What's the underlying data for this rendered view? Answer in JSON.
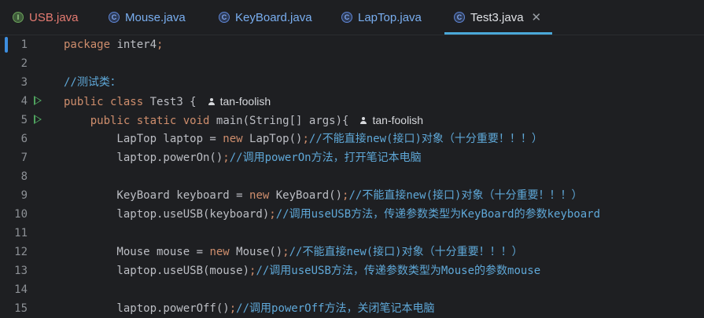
{
  "tabs": [
    {
      "label": "USB.java",
      "icon": "interface-icon",
      "icon_letter": "I",
      "state": "error"
    },
    {
      "label": "Mouse.java",
      "icon": "class-icon",
      "icon_letter": "C",
      "state": "modified"
    },
    {
      "label": "KeyBoard.java",
      "icon": "class-icon",
      "icon_letter": "C",
      "state": "modified"
    },
    {
      "label": "LapTop.java",
      "icon": "class-icon",
      "icon_letter": "C",
      "state": "modified"
    },
    {
      "label": "Test3.java",
      "icon": "class-icon",
      "icon_letter": "C",
      "state": "active",
      "close": "✕"
    }
  ],
  "author_hint": "tan-foolish",
  "lines": [
    {
      "n": "1",
      "code": "package inter4;"
    },
    {
      "n": "2",
      "code": ""
    },
    {
      "n": "3",
      "code": "//测试类："
    },
    {
      "n": "4",
      "code": "public class Test3 {"
    },
    {
      "n": "5",
      "code": "    public static void main(String[] args){"
    },
    {
      "n": "6",
      "code": "        LapTop laptop = new LapTop();//不能直接new(接口)对象（十分重要！！！）"
    },
    {
      "n": "7",
      "code": "        laptop.powerOn();//调用powerOn方法，打开笔记本电脑"
    },
    {
      "n": "8",
      "code": ""
    },
    {
      "n": "9",
      "code": "        KeyBoard keyboard = new KeyBoard();//不能直接new(接口)对象（十分重要！！！）"
    },
    {
      "n": "10",
      "code": "        laptop.useUSB(keyboard);//调用useUSB方法，传递参数类型为KeyBoard的参数keyboard"
    },
    {
      "n": "11",
      "code": ""
    },
    {
      "n": "12",
      "code": "        Mouse mouse = new Mouse();//不能直接new(接口)对象（十分重要！！！）"
    },
    {
      "n": "13",
      "code": "        laptop.useUSB(mouse);//调用useUSB方法，传递参数类型为Mouse的参数mouse"
    },
    {
      "n": "14",
      "code": ""
    },
    {
      "n": "15",
      "code": "        laptop.powerOff();//调用powerOff方法，关闭笔记本电脑"
    }
  ],
  "colors": {
    "keyword": "#cf8e6d",
    "comment": "#5fa8d8",
    "text": "#bcbec4",
    "active_tab_underline": "#4aa8d8",
    "run_icon": "#4fa35f"
  }
}
